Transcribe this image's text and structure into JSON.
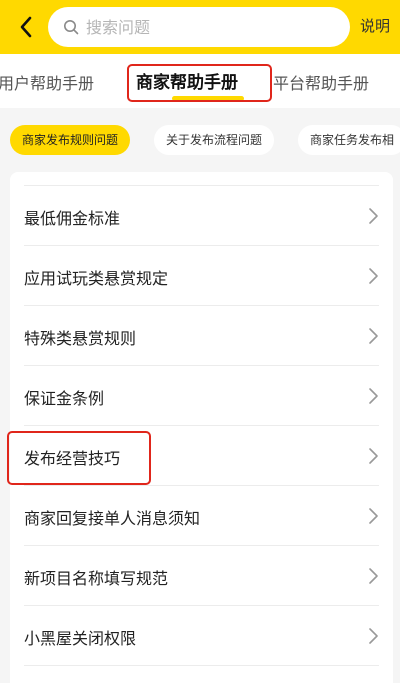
{
  "header": {
    "search_placeholder": "搜索问题",
    "help_label": "说明",
    "back_icon": "chevron-left-icon",
    "search_icon": "search-icon",
    "background_color": "#ffd900"
  },
  "tabs": [
    {
      "label": "用户帮助手册",
      "active": false
    },
    {
      "label": "商家帮助手册",
      "active": true
    },
    {
      "label": "平台帮助手册",
      "active": false
    }
  ],
  "chips": [
    {
      "label": "商家发布规则问题",
      "active": true
    },
    {
      "label": "关于发布流程问题",
      "active": false
    },
    {
      "label": "商家任务发布相",
      "active": false
    }
  ],
  "list": {
    "items": [
      {
        "label": "最低佣金标准"
      },
      {
        "label": "应用试玩类悬赏规定"
      },
      {
        "label": "特殊类悬赏规则"
      },
      {
        "label": "保证金条例"
      },
      {
        "label": "发布经营技巧"
      },
      {
        "label": "商家回复接单人消息须知"
      },
      {
        "label": "新项目名称填写规范"
      },
      {
        "label": "小黑屋关闭权限"
      }
    ],
    "chevron_icon": "chevron-right-icon"
  },
  "colors": {
    "accent": "#ffd900",
    "highlight": "#e0261b"
  }
}
